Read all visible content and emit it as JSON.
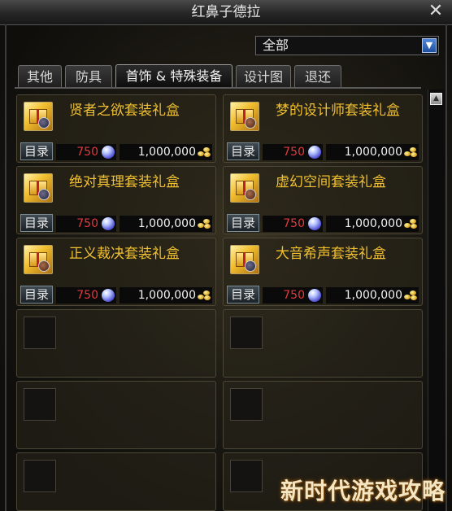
{
  "window": {
    "title": "红鼻子德拉"
  },
  "filter": {
    "selected": "全部"
  },
  "tabs": [
    {
      "label": "其他"
    },
    {
      "label": "防具"
    },
    {
      "label": "首饰 & 特殊装备",
      "active": true
    },
    {
      "label": "设计图"
    },
    {
      "label": "退还"
    }
  ],
  "items": [
    {
      "name": "贤者之欲套装礼盒",
      "button": "目录",
      "price": "750",
      "gold": "1,000,000"
    },
    {
      "name": "梦的设计师套装礼盒",
      "button": "目录",
      "price": "750",
      "gold": "1,000,000"
    },
    {
      "name": "绝对真理套装礼盒",
      "button": "目录",
      "price": "750",
      "gold": "1,000,000"
    },
    {
      "name": "虚幻空间套装礼盒",
      "button": "目录",
      "price": "750",
      "gold": "1,000,000"
    },
    {
      "name": "正义裁决套装礼盒",
      "button": "目录",
      "price": "750",
      "gold": "1,000,000"
    },
    {
      "name": "大音希声套装礼盒",
      "button": "目录",
      "price": "750",
      "gold": "1,000,000"
    }
  ],
  "icons": {
    "close": "close-icon",
    "dropdown": "chevron-down-icon",
    "price_currency": "gem-icon",
    "gold_currency": "gold-coin-icon",
    "item": "gift-box-icon"
  },
  "colors": {
    "item_name": "#f0c030",
    "price": "#e23a3a",
    "gold": "#f2f2f2"
  },
  "watermark": "新时代游戏攻略"
}
